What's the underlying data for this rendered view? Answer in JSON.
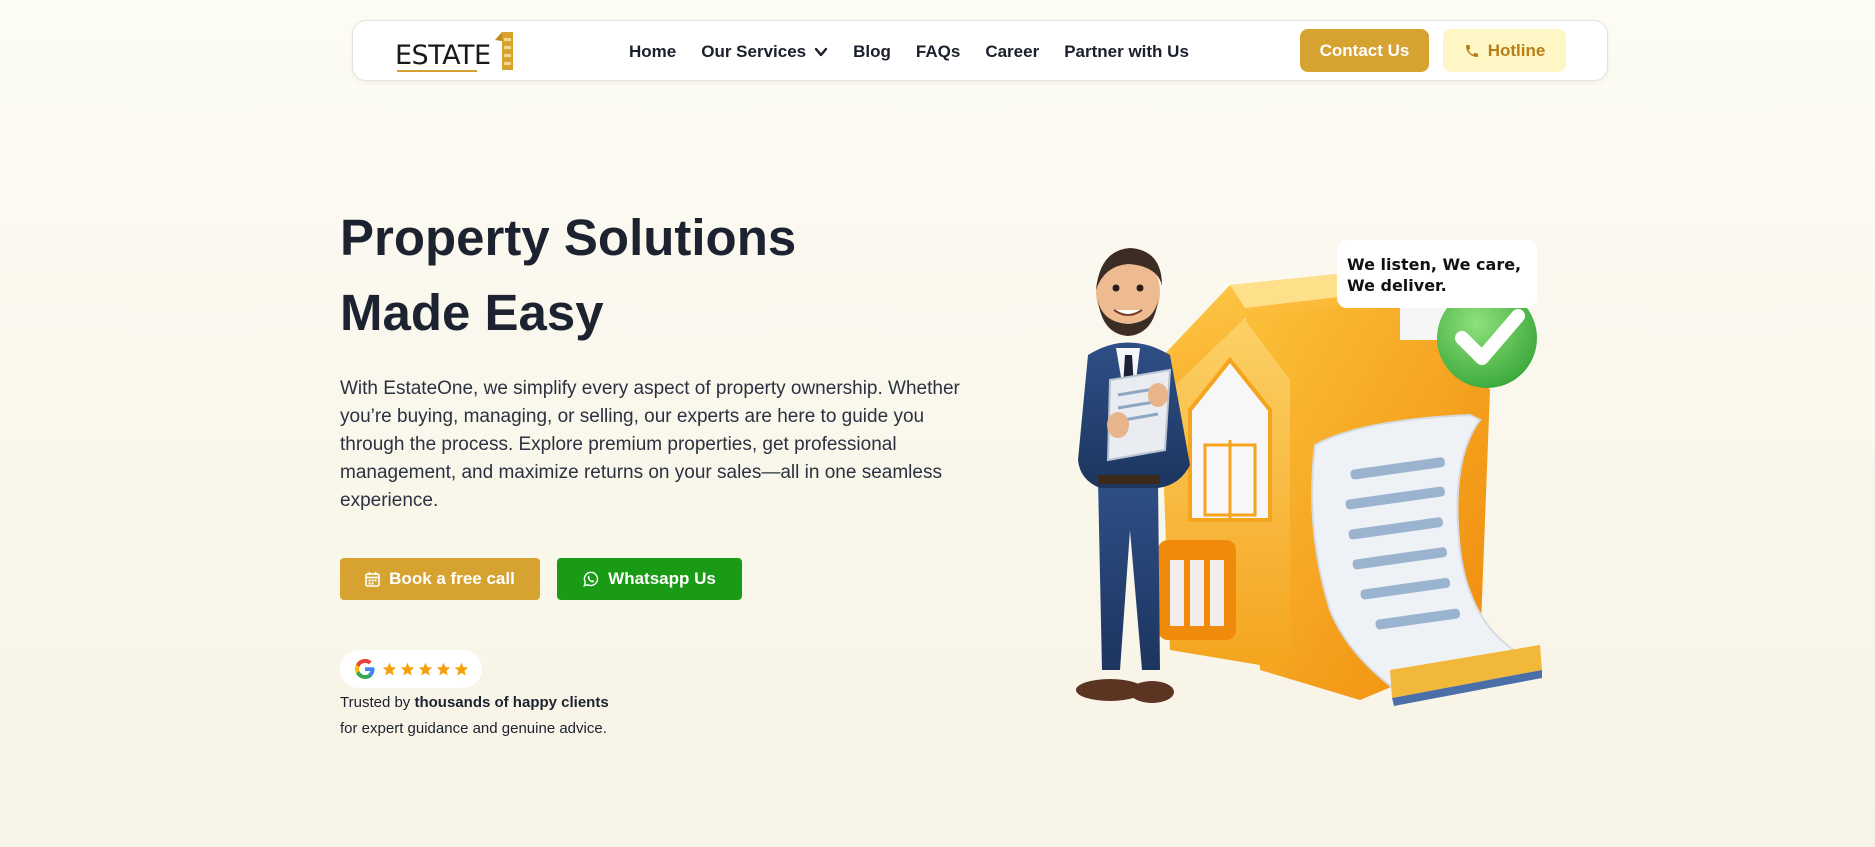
{
  "nav": {
    "logo_text": "ESTATE",
    "items": [
      {
        "label": "Home"
      },
      {
        "label": "Our Services"
      },
      {
        "label": "Blog"
      },
      {
        "label": "FAQs"
      },
      {
        "label": "Career"
      },
      {
        "label": "Partner with Us"
      }
    ],
    "contact_label": "Contact Us",
    "hotline_label": "Hotline"
  },
  "hero": {
    "title_line1": "Property Solutions",
    "title_line2": "Made Easy",
    "description": "With EstateOne, we simplify every aspect of property ownership. Whether you’re buying, managing, or selling, our experts are here to guide you through the process. Explore premium properties, get professional management, and maximize returns on your sales—all in one seamless experience.",
    "book_label": "Book a free call",
    "whatsapp_label": "Whatsapp Us",
    "rating": 5,
    "trusted_prefix": "Trusted by",
    "trusted_bold": "thousands of happy clients",
    "trusted_line2": "for expert guidance and genuine advice.",
    "bubble_text": "We listen, We care, We deliver."
  },
  "colors": {
    "accent": "#d6a230",
    "whatsapp": "#1a9b15",
    "hotline_bg": "#fef6c4",
    "text": "#1c2230"
  },
  "icons": [
    "chevron-down-icon",
    "phone-icon",
    "calendar-icon",
    "whatsapp-icon",
    "google-icon",
    "star-icon"
  ]
}
